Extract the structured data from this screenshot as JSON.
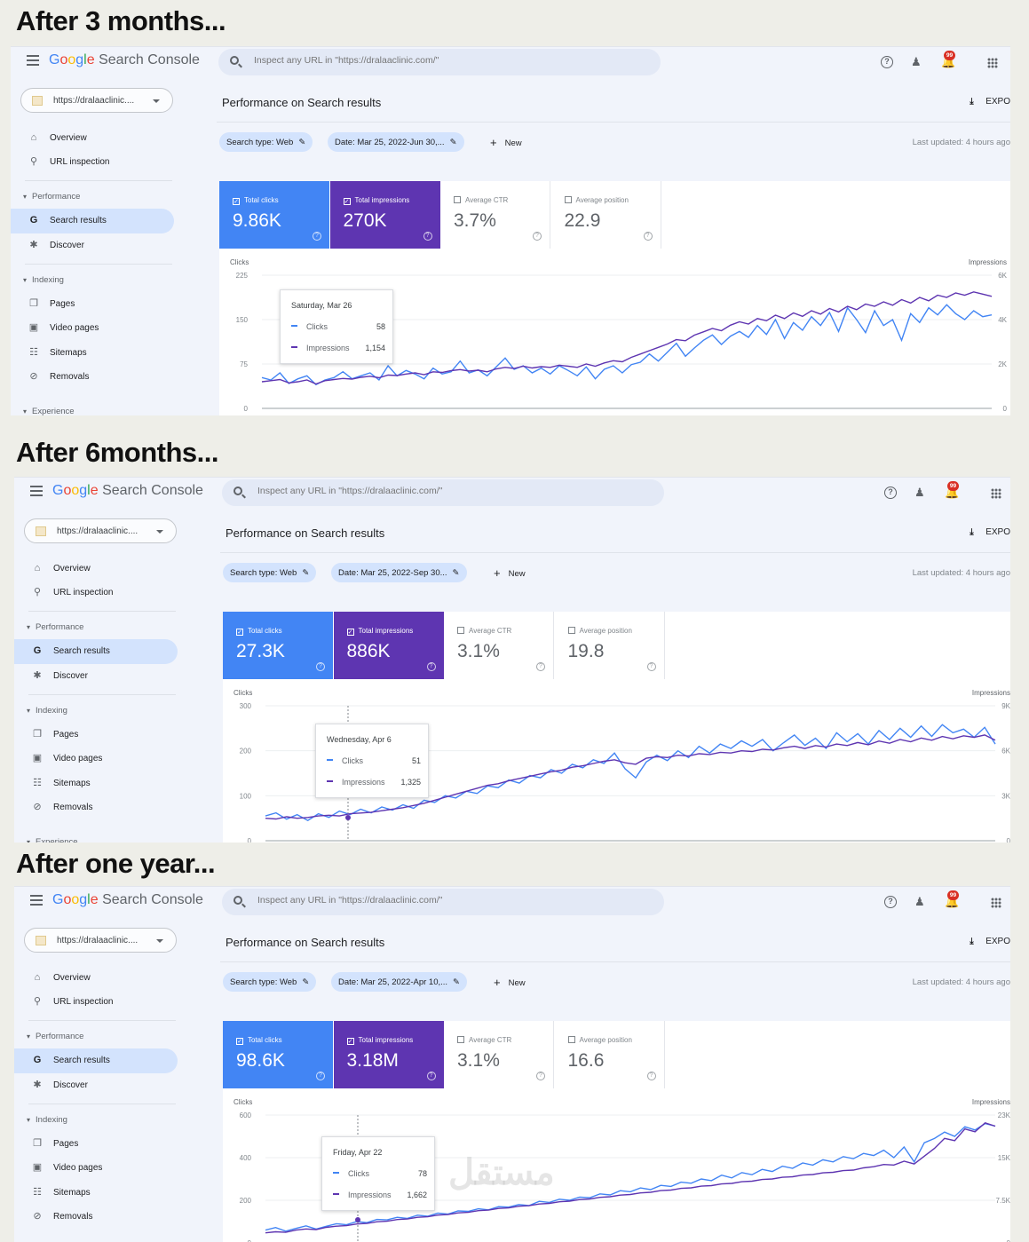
{
  "common": {
    "logo_google": "Google",
    "logo_product": "Search Console",
    "search_placeholder": "Inspect any URL in \"https://dralaaclinic.com/\"",
    "notification_count": "99",
    "property": "https://dralaaclinic....",
    "nav": {
      "overview": "Overview",
      "url_inspection": "URL inspection",
      "performance": "Performance",
      "search_results": "Search results",
      "discover": "Discover",
      "indexing": "Indexing",
      "pages": "Pages",
      "video_pages": "Video pages",
      "sitemaps": "Sitemaps",
      "removals": "Removals",
      "experience": "Experience"
    },
    "page_title": "Performance on Search results",
    "export_label": "EXPO",
    "search_type_chip": "Search type: Web",
    "new_label": "New",
    "metric_labels": {
      "clicks": "Total clicks",
      "impressions": "Total impressions",
      "ctr": "Average CTR",
      "position": "Average position"
    },
    "axis_left_label": "Clicks",
    "axis_right_label": "Impressions",
    "tooltip_clicks_label": "Clicks",
    "tooltip_impressions_label": "Impressions",
    "colors": {
      "clicks": "#4285f4",
      "impressions": "#5e35b1",
      "active_nav": "#d3e3fd"
    }
  },
  "panels": [
    {
      "heading": "After 3 months...",
      "date_chip": "Date: Mar 25, 2022-Jun 30,...",
      "last_updated": "Last updated: 4 hours ago",
      "metrics": {
        "clicks": "9.86K",
        "impressions": "270K",
        "ctr": "3.7%",
        "position": "22.9"
      },
      "tooltip": {
        "date": "Saturday, Mar 26",
        "clicks": "58",
        "impressions": "1,154"
      }
    },
    {
      "heading": "After 6months...",
      "date_chip": "Date: Mar 25, 2022-Sep 30...",
      "last_updated": "Last updated: 4 hours ago",
      "metrics": {
        "clicks": "27.3K",
        "impressions": "886K",
        "ctr": "3.1%",
        "position": "19.8"
      },
      "tooltip": {
        "date": "Wednesday, Apr 6",
        "clicks": "51",
        "impressions": "1,325"
      }
    },
    {
      "heading": "After one year...",
      "date_chip": "Date: Mar 25, 2022-Apr 10,...",
      "last_updated": "Last updated: 4 hours ago",
      "metrics": {
        "clicks": "98.6K",
        "impressions": "3.18M",
        "ctr": "3.1%",
        "position": "16.6"
      },
      "tooltip": {
        "date": "Friday, Apr 22",
        "clicks": "78",
        "impressions": "1,662"
      }
    }
  ],
  "chart_data": [
    {
      "type": "line",
      "title": "",
      "xlabel": "",
      "ylabel": "Clicks",
      "y2label": "Impressions",
      "ylim": [
        0,
        225
      ],
      "y2lim": [
        0,
        6000
      ],
      "yticks": [
        "0",
        "75",
        "150",
        "225"
      ],
      "y2ticks": [
        "0",
        "2K",
        "4K",
        "6K"
      ],
      "series": [
        {
          "name": "Clicks",
          "axis": "left",
          "values": [
            52,
            48,
            60,
            42,
            50,
            55,
            40,
            48,
            52,
            62,
            50,
            55,
            60,
            48,
            72,
            55,
            64,
            58,
            50,
            68,
            58,
            62,
            80,
            60,
            65,
            55,
            70,
            85,
            66,
            72,
            60,
            68,
            58,
            72,
            64,
            55,
            70,
            50,
            66,
            72,
            60,
            74,
            78,
            92,
            80,
            95,
            110,
            88,
            102,
            115,
            124,
            108,
            122,
            130,
            120,
            140,
            125,
            150,
            118,
            145,
            132,
            155,
            140,
            162,
            130,
            170,
            150,
            128,
            165,
            140,
            150,
            115,
            160,
            145,
            170,
            158,
            175,
            160,
            150,
            165,
            155,
            158
          ]
        },
        {
          "name": "Impressions",
          "axis": "right",
          "values": [
            1200,
            1250,
            1300,
            1150,
            1200,
            1280,
            1100,
            1250,
            1300,
            1350,
            1320,
            1400,
            1450,
            1380,
            1500,
            1480,
            1550,
            1600,
            1520,
            1650,
            1620,
            1700,
            1750,
            1680,
            1720,
            1650,
            1780,
            1850,
            1800,
            1900,
            1820,
            1880,
            1850,
            1950,
            1900,
            1850,
            2000,
            1900,
            2050,
            2150,
            2100,
            2300,
            2450,
            2600,
            2750,
            2900,
            3100,
            3050,
            3300,
            3450,
            3600,
            3500,
            3750,
            3900,
            3800,
            4050,
            3950,
            4200,
            4050,
            4300,
            4150,
            4400,
            4250,
            4500,
            4350,
            4600,
            4450,
            4700,
            4600,
            4800,
            4650,
            4900,
            4750,
            5000,
            4850,
            5100,
            5000,
            5200,
            5100,
            5250,
            5150,
            5050
          ]
        }
      ],
      "legend": "none",
      "grid": true
    },
    {
      "type": "line",
      "title": "",
      "xlabel": "",
      "ylabel": "Clicks",
      "y2label": "Impressions",
      "ylim": [
        0,
        300
      ],
      "y2lim": [
        0,
        9000
      ],
      "yticks": [
        "0",
        "100",
        "200",
        "300"
      ],
      "y2ticks": [
        "0",
        "3K",
        "6K",
        "9K"
      ],
      "series": [
        {
          "name": "Clicks",
          "axis": "left",
          "values": [
            55,
            62,
            48,
            58,
            45,
            60,
            52,
            66,
            58,
            70,
            62,
            75,
            68,
            80,
            72,
            90,
            85,
            100,
            95,
            110,
            105,
            122,
            118,
            135,
            128,
            145,
            140,
            158,
            150,
            170,
            162,
            180,
            172,
            195,
            160,
            140,
            175,
            190,
            178,
            200,
            185,
            210,
            195,
            215,
            205,
            222,
            210,
            225,
            200,
            218,
            235,
            212,
            228,
            205,
            240,
            220,
            238,
            215,
            245,
            225,
            250,
            230,
            255,
            232,
            258,
            240,
            248,
            230,
            252,
            215
          ]
        },
        {
          "name": "Impressions",
          "axis": "right",
          "values": [
            1500,
            1450,
            1600,
            1500,
            1550,
            1650,
            1700,
            1650,
            1800,
            1850,
            1900,
            2000,
            2100,
            2200,
            2350,
            2500,
            2700,
            2900,
            3100,
            3300,
            3500,
            3700,
            3800,
            4000,
            4150,
            4300,
            4450,
            4600,
            4700,
            4900,
            5000,
            5150,
            5300,
            5400,
            5200,
            5100,
            5500,
            5600,
            5550,
            5700,
            5650,
            5800,
            5750,
            5900,
            5850,
            6000,
            5950,
            6100,
            6050,
            6200,
            6300,
            6150,
            6350,
            6250,
            6450,
            6350,
            6550,
            6400,
            6650,
            6500,
            6750,
            6600,
            6850,
            6700,
            6950,
            6800,
            7000,
            6900,
            7050,
            6700
          ]
        }
      ],
      "legend": "none",
      "grid": true
    },
    {
      "type": "line",
      "title": "",
      "xlabel": "",
      "ylabel": "Clicks",
      "y2label": "Impressions",
      "ylim": [
        0,
        600
      ],
      "y2lim": [
        0,
        23000
      ],
      "yticks": [
        "0",
        "200",
        "400",
        "600"
      ],
      "y2ticks": [
        "0",
        "7.5K",
        "15K",
        "23K"
      ],
      "series": [
        {
          "name": "Clicks",
          "axis": "left",
          "values": [
            60,
            72,
            55,
            68,
            80,
            65,
            78,
            90,
            85,
            100,
            95,
            110,
            108,
            120,
            115,
            130,
            125,
            140,
            135,
            150,
            148,
            160,
            155,
            170,
            168,
            180,
            175,
            195,
            190,
            205,
            200,
            215,
            212,
            230,
            225,
            245,
            240,
            258,
            250,
            270,
            265,
            285,
            280,
            300,
            292,
            318,
            305,
            330,
            320,
            345,
            335,
            360,
            350,
            375,
            365,
            390,
            380,
            405,
            395,
            420,
            410,
            435,
            400,
            450,
            380,
            470,
            490,
            520,
            500,
            545,
            530,
            560,
            548
          ]
        },
        {
          "name": "Impressions",
          "axis": "right",
          "values": [
            1800,
            2000,
            1900,
            2300,
            2500,
            2400,
            2800,
            3000,
            3100,
            3400,
            3500,
            3800,
            3900,
            4200,
            4300,
            4600,
            4700,
            5000,
            5100,
            5400,
            5500,
            5800,
            5900,
            6200,
            6300,
            6600,
            6700,
            7000,
            7100,
            7400,
            7500,
            7800,
            7900,
            8200,
            8300,
            8600,
            8700,
            9000,
            9100,
            9400,
            9500,
            9800,
            9900,
            10200,
            10300,
            10600,
            10700,
            11000,
            11100,
            11400,
            11500,
            11800,
            11900,
            12200,
            12300,
            12600,
            12700,
            13000,
            13100,
            13500,
            13700,
            14100,
            14000,
            14700,
            14200,
            15600,
            17000,
            18800,
            18400,
            20500,
            20000,
            21600,
            21000
          ]
        }
      ],
      "legend": "none",
      "grid": true
    }
  ]
}
